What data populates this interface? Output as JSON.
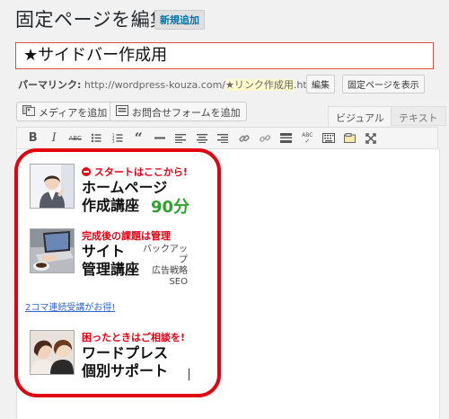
{
  "header": {
    "page_title": "固定ページを編集",
    "add_new": "新規追加"
  },
  "post": {
    "title": "★サイドバー作成用"
  },
  "permalink": {
    "label": "パーマリンク:",
    "url_base": "http://wordpress-kouza.com/",
    "slug": "★リンク作成用",
    "suffix": ".html",
    "edit_button": "編集",
    "view_button": "固定ページを表示"
  },
  "media_buttons": {
    "add_media": "メディアを追加",
    "add_form": "お問合せフォームを追加"
  },
  "editor_tabs": {
    "visual": "ビジュアル",
    "text": "テキスト"
  },
  "toolbar": [
    {
      "name": "bold",
      "glyph": "B"
    },
    {
      "name": "italic",
      "glyph": "I"
    },
    {
      "name": "strikethrough",
      "glyph": "ABC"
    },
    {
      "name": "bullet-list",
      "glyph": "≡"
    },
    {
      "name": "numbered-list",
      "glyph": "≡"
    },
    {
      "name": "blockquote",
      "glyph": "❝"
    },
    {
      "name": "horizontal-rule",
      "glyph": "—"
    },
    {
      "name": "align-left",
      "glyph": "≡"
    },
    {
      "name": "align-center",
      "glyph": "≡"
    },
    {
      "name": "align-right",
      "glyph": "≡"
    },
    {
      "name": "link",
      "glyph": "🔗"
    },
    {
      "name": "unlink",
      "glyph": "⛓"
    },
    {
      "name": "read-more",
      "glyph": "▬"
    },
    {
      "name": "spellcheck",
      "glyph": "ABC"
    },
    {
      "name": "keyboard",
      "glyph": "⌨"
    },
    {
      "name": "toolbar-toggle",
      "glyph": "▤"
    },
    {
      "name": "fullscreen",
      "glyph": "⤢"
    }
  ],
  "content": {
    "block1": {
      "tagline": "スタートはここから!",
      "line1": "ホームページ",
      "line2": "作成講座",
      "duration": "90分"
    },
    "block2": {
      "tagline": "完成後の課題は管理",
      "line1": "サイト",
      "line2": "管理講座",
      "tag1": "バックアップ",
      "tag2": "広告戦略",
      "tag3": "SEO"
    },
    "promo_link": "2コマ連続受講がお得!",
    "block3": {
      "tagline": "困ったときはご相談を!",
      "line1": "ワードプレス",
      "line2": "個別サポート"
    }
  },
  "colors": {
    "accent_red": "#e60012",
    "frame_red": "#e00010",
    "green": "#2ea12e",
    "link_blue": "#3366cc"
  }
}
